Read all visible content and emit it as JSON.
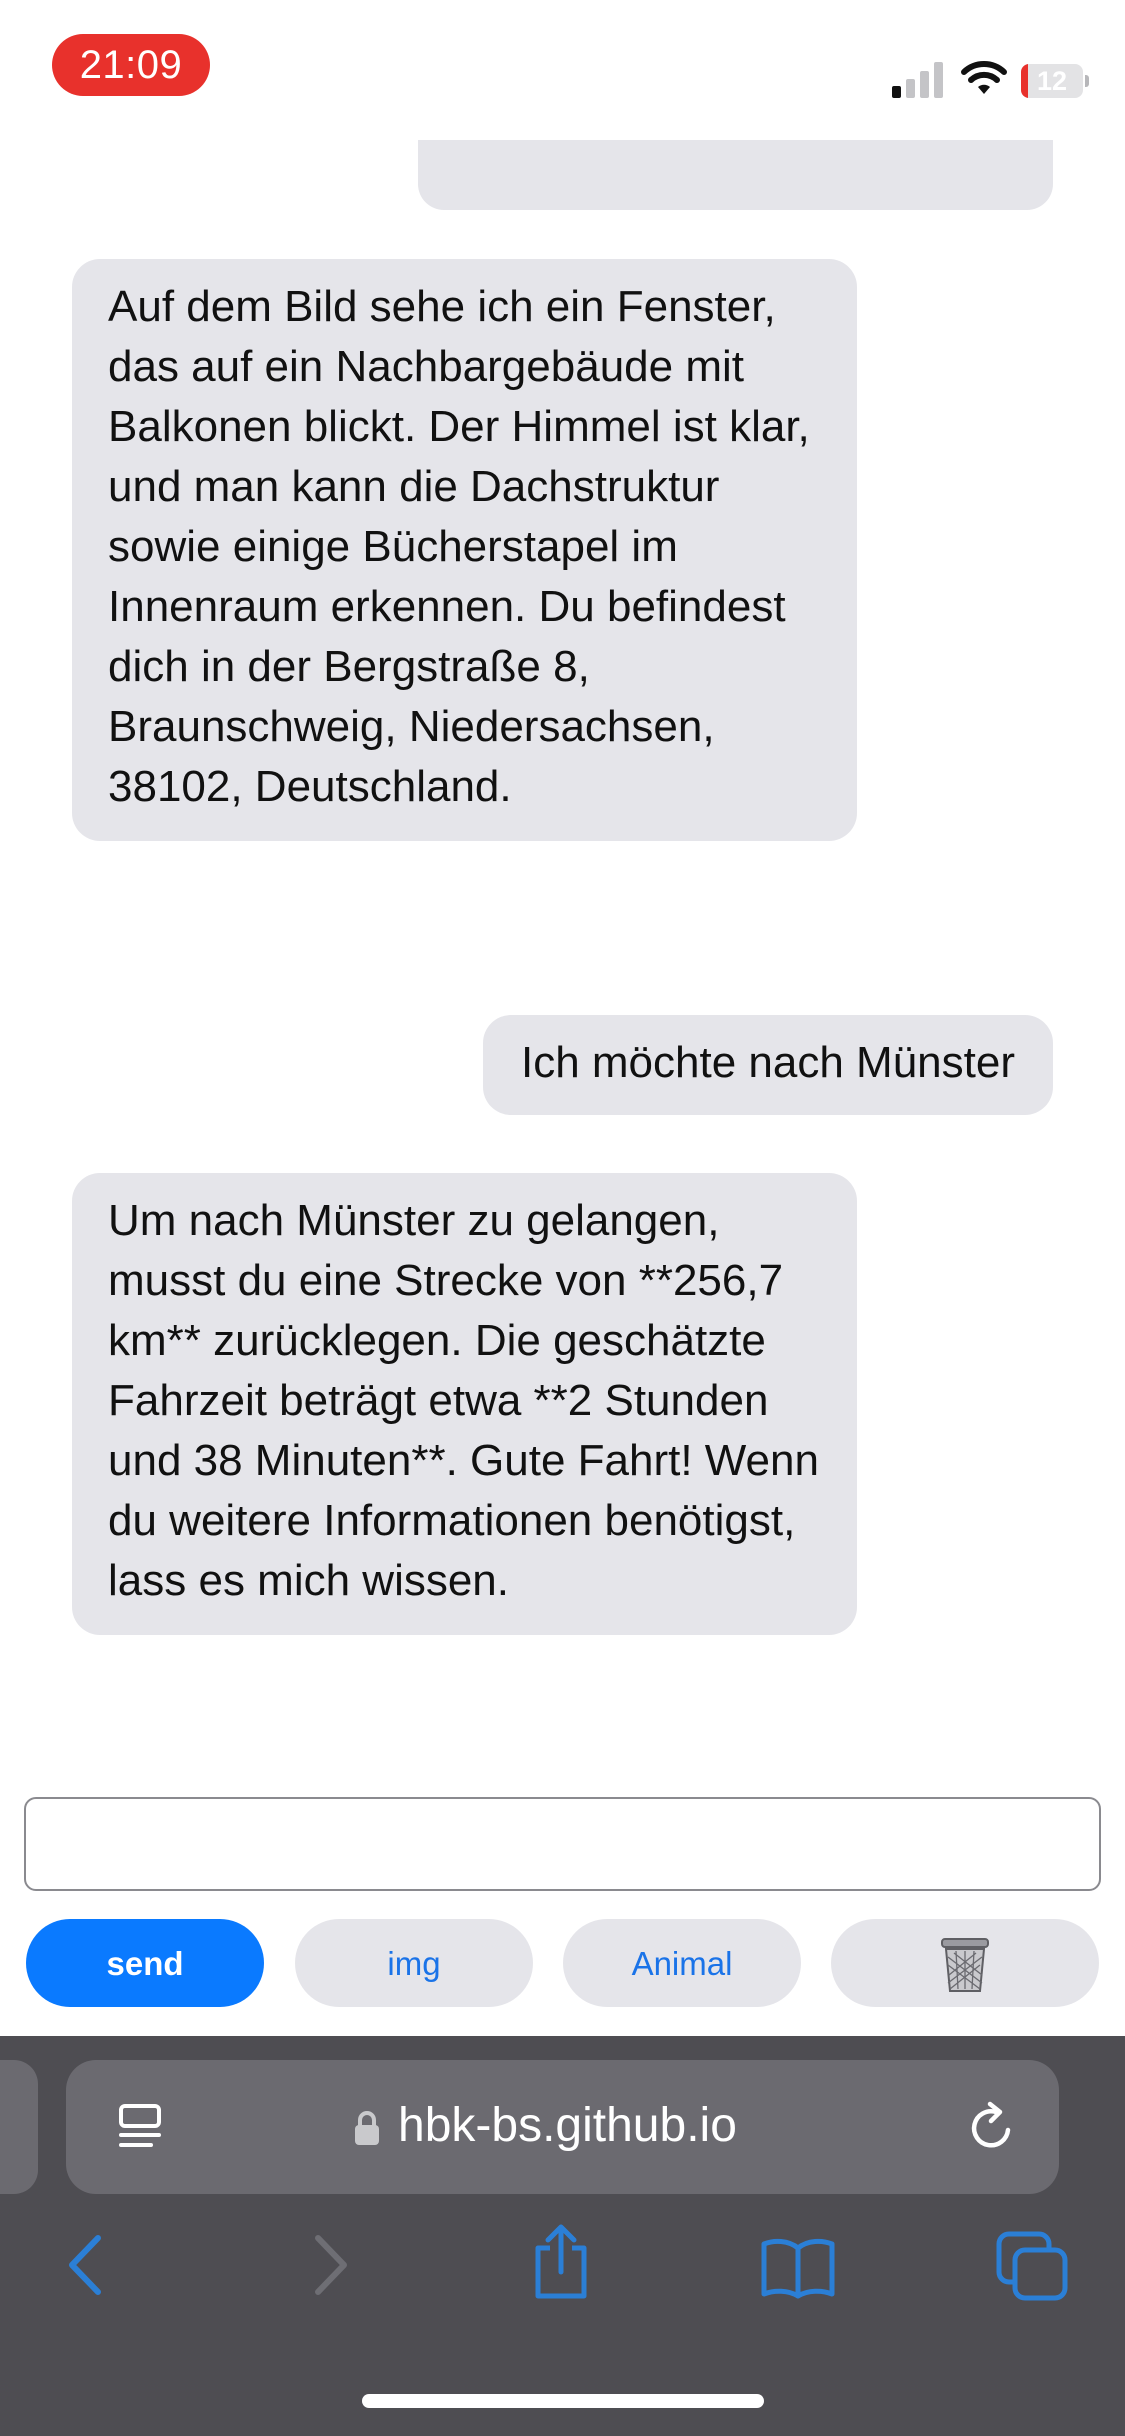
{
  "status_bar": {
    "time": "21:09",
    "battery_level": "12",
    "battery_fraction": 0.12,
    "signal_bars_active": 1,
    "signal_bars_total": 4
  },
  "chat": {
    "messages": [
      {
        "sender": "assistant",
        "text": "Auf dem Bild sehe ich ein Fenster, das auf ein Nachbargebäude mit Balkonen blickt. Der Himmel ist klar, und man kann die Dachstruktur sowie einige Bücherstapel im Innenraum erkennen. Du befindest dich in der Bergstraße 8, Braunschweig, Niedersachsen, 38102, Deutschland."
      },
      {
        "sender": "user",
        "text": "Ich möchte nach Münster"
      },
      {
        "sender": "assistant",
        "text": "Um nach Münster zu gelangen, musst du eine Strecke von **256,7 km** zurücklegen. Die geschätzte Fahrzeit beträgt etwa **2 Stunden und 38 Minuten**. Gute Fahrt! Wenn du weitere Informationen benötigst, lass es mich wissen."
      }
    ]
  },
  "composer": {
    "input_value": "",
    "input_placeholder": ""
  },
  "buttons": {
    "send_label": "send",
    "img_label": "img",
    "animal_label": "Animal",
    "trash_icon": "trash-icon"
  },
  "browser": {
    "url": "hbk-bs.github.io",
    "icons": [
      "reader-icon",
      "lock-icon",
      "reload-icon",
      "back-icon",
      "forward-icon",
      "share-icon",
      "bookmarks-icon",
      "tabs-icon"
    ]
  },
  "colors": {
    "send_button": "#0a7aff",
    "bubble": "#e5e5ea",
    "time_pill": "#e8312c",
    "toolbar": "#4e4d52",
    "link_blue": "#1a73e8",
    "nav_blue": "#2b7fd6"
  }
}
